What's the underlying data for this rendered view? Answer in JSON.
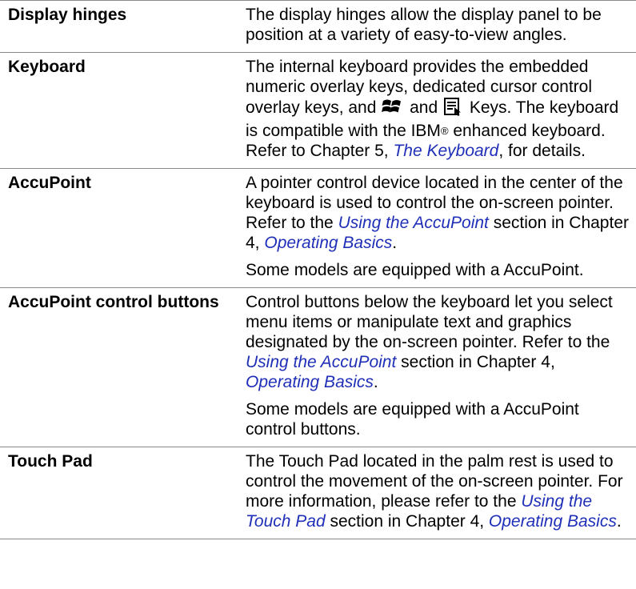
{
  "rows": [
    {
      "term": "Display hinges",
      "description": "The display hinges allow the display panel to be position at a variety of easy-to-view angles."
    },
    {
      "term": "Keyboard",
      "text_1": "The internal keyboard provides the embedded numeric overlay keys, dedicated cursor control overlay keys, and ",
      "text_and": " and ",
      "text_2": " Keys. The keyboard is compatible with the IBM",
      "reg_mark": "®",
      "text_3": " enhanced keyboard. Refer to Chapter 5, ",
      "link_keyboard": "The Keyboard",
      "text_4": ", for details."
    },
    {
      "term": "AccuPoint",
      "p1_text_1": "A pointer control device located in the center of the keyboard is used to control the on-screen pointer. Refer to the ",
      "p1_link_1": "Using the AccuPoint",
      "p1_text_2": " section in Chapter 4, ",
      "p1_link_2": "Operating Basics",
      "p1_text_3": ".",
      "p2": "Some models are equipped with a AccuPoint."
    },
    {
      "term": "AccuPoint control buttons",
      "p1_text_1": "Control buttons below the keyboard let you select menu items or manipulate text and graphics designated by the on-screen pointer. Refer to the ",
      "p1_link_1": "Using the AccuPoint",
      "p1_text_2": " section in Chapter 4, ",
      "p1_link_2": "Operating Basics",
      "p1_text_3": ".",
      "p2": "Some models are equipped with a AccuPoint control buttons."
    },
    {
      "term": "Touch Pad",
      "text_1": "The Touch Pad located in the palm rest is used to control the movement of the on-screen pointer. For more information, please refer to the ",
      "link_1": "Using the Touch Pad",
      "text_2": " section in Chapter 4, ",
      "link_2": "Operating Basics",
      "text_3": "."
    }
  ],
  "icons": {
    "windows_key": "windows-logo-icon",
    "application_key": "application-menu-icon"
  }
}
